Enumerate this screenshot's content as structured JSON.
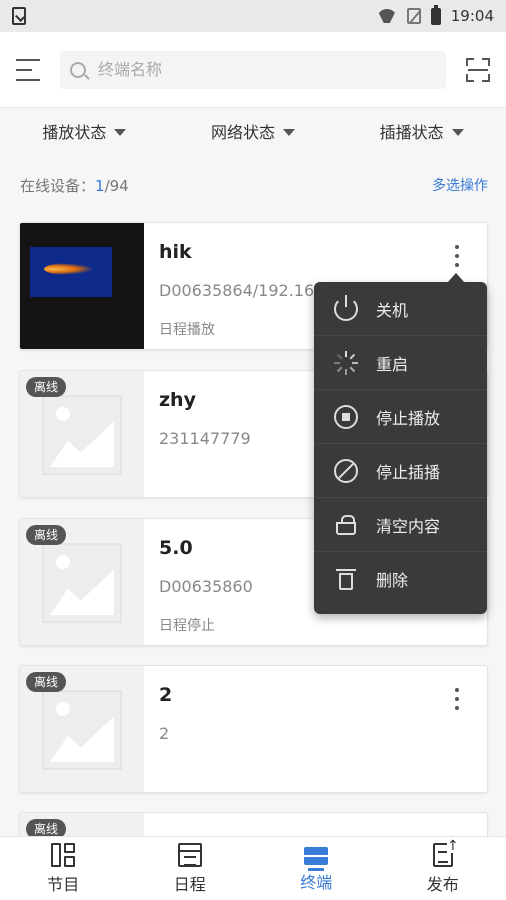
{
  "status_bar": {
    "time": "19:04"
  },
  "header": {
    "search_placeholder": "终端名称"
  },
  "filters": [
    "播放状态",
    "网络状态",
    "插播状态"
  ],
  "summary": {
    "label": "在线设备：",
    "online": "1",
    "total": "/94",
    "multi_select": "多选操作"
  },
  "devices": [
    {
      "name": "hik",
      "id": "D00635864/192.168.1.197",
      "status": "日程播放",
      "badge": ""
    },
    {
      "name": "zhy",
      "id": "231147779",
      "status": "",
      "badge": "离线"
    },
    {
      "name": "5.0",
      "id": "D00635860",
      "status": "日程停止",
      "badge": "离线"
    },
    {
      "name": "2",
      "id": "2",
      "status": "",
      "badge": "离线"
    },
    {
      "name": "",
      "id": "",
      "status": "",
      "badge": "离线"
    }
  ],
  "popup_menu": [
    "关机",
    "重启",
    "停止播放",
    "停止插播",
    "清空内容",
    "删除"
  ],
  "bottom_nav": [
    {
      "label": "节目",
      "icon": "program-icon"
    },
    {
      "label": "日程",
      "icon": "schedule-icon"
    },
    {
      "label": "终端",
      "icon": "terminal-icon",
      "active": true
    },
    {
      "label": "发布",
      "icon": "publish-icon"
    }
  ],
  "colors": {
    "accent": "#3a7bd5",
    "popup_bg": "#3a3a3a",
    "badge_bg": "#555555"
  }
}
